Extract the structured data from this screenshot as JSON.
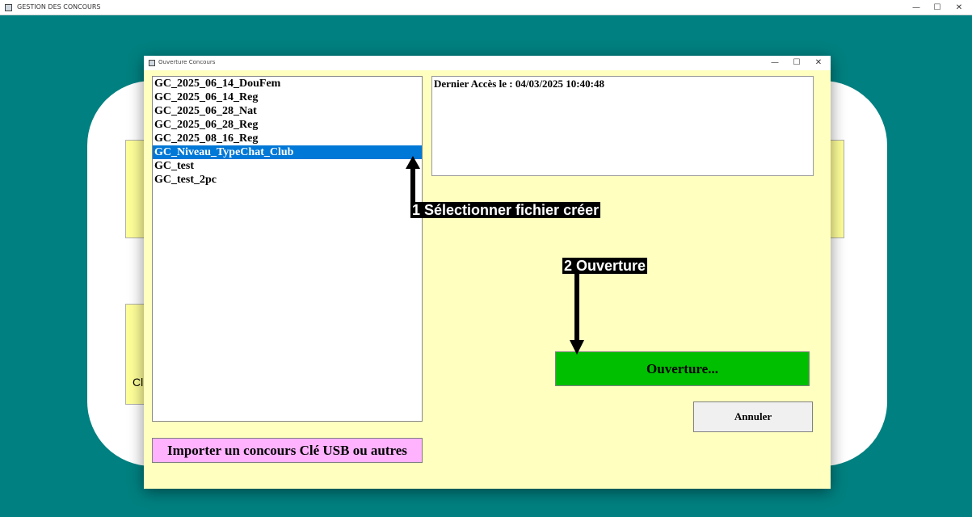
{
  "main_window": {
    "title": "GESTION DES CONCOURS",
    "controls": {
      "minimize": "—",
      "maximize": "☐",
      "close": "✕"
    }
  },
  "background": {
    "partial_label": "Cl"
  },
  "dialog": {
    "title": "Ouverture Concours",
    "controls": {
      "minimize": "—",
      "maximize": "☐",
      "close": "✕"
    },
    "files": [
      "GC_2025_06_14_DouFem",
      "GC_2025_06_14_Reg",
      "GC_2025_06_28_Nat",
      "GC_2025_06_28_Reg",
      "GC_2025_08_16_Reg",
      "GC_Niveau_TypeChat_Club",
      "GC_test",
      "GC_test_2pc"
    ],
    "selected_index": 5,
    "info_text": "Dernier Accès le : 04/03/2025 10:40:48",
    "open_button": "Ouverture...",
    "cancel_button": "Annuler",
    "import_button": "Importer un concours Clé USB ou autres"
  },
  "annotations": {
    "step1": "1 Sélectionner fichier créer",
    "step2": "2 Ouverture"
  },
  "colors": {
    "desktop": "#008080",
    "dialog_bg": "#ffffc0",
    "selection": "#0078d7",
    "open_button": "#00bf00",
    "import_button": "#ffb3ff"
  }
}
